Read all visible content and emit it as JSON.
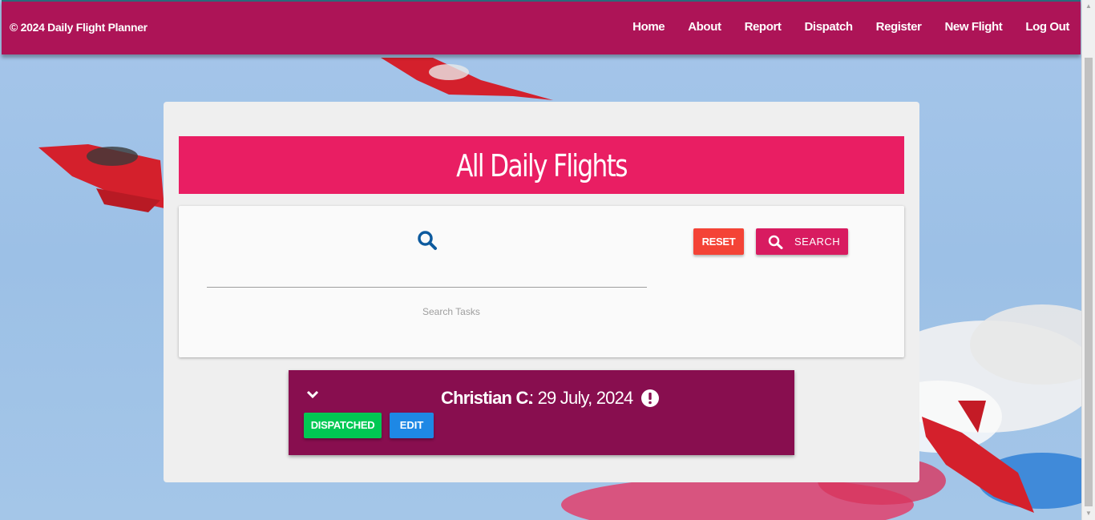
{
  "navbar": {
    "brand": "© 2024 Daily Flight Planner",
    "links": [
      "Home",
      "About",
      "Report",
      "Dispatch",
      "Register",
      "New Flight",
      "Log Out"
    ]
  },
  "main": {
    "title": "All Daily Flights",
    "search": {
      "placeholder": "",
      "hint": "Search Tasks",
      "reset_label": "RESET",
      "search_label": "SEARCH"
    },
    "flights": [
      {
        "name": "Christian C.",
        "date": ": 29 July, 2024",
        "status_label": "DISPATCHED",
        "edit_label": "EDIT"
      }
    ]
  },
  "colors": {
    "navbar": "#ad1457",
    "title_bar": "#e91e63",
    "flight_card": "#880e4f",
    "reset": "#f44336",
    "search": "#d81b60",
    "dispatched": "#00c853",
    "edit": "#1e88e5"
  },
  "icons": [
    "search-icon",
    "chevron-down-icon",
    "alert-icon"
  ]
}
